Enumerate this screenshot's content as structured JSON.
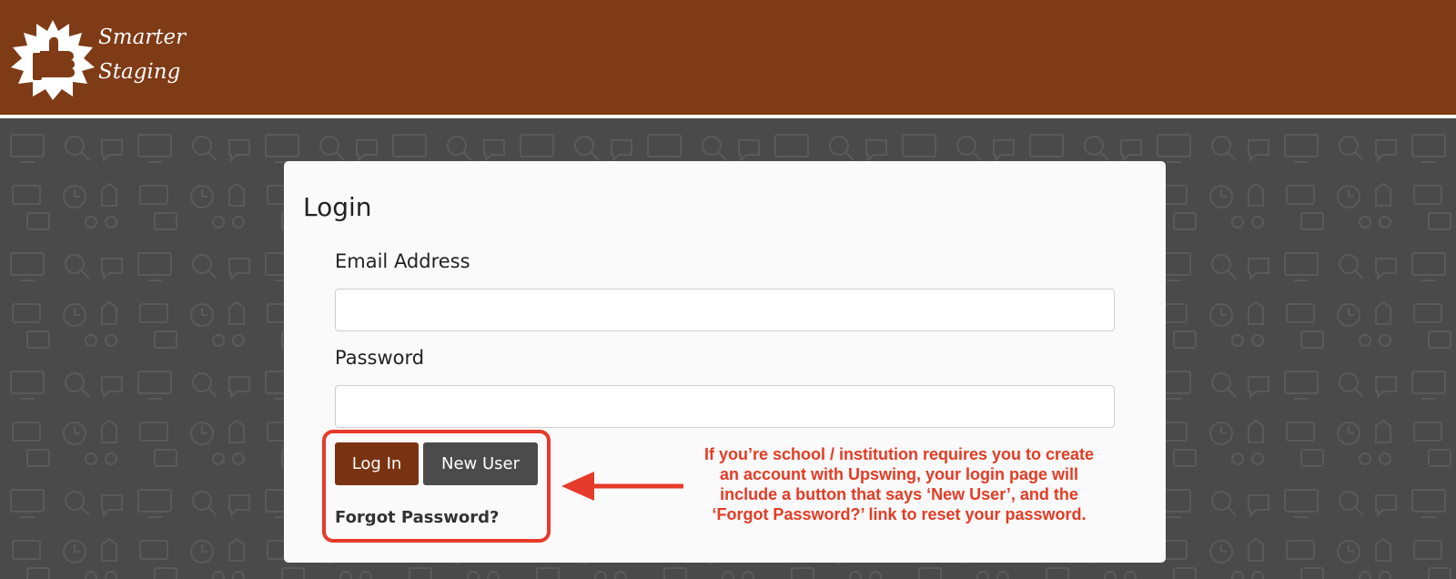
{
  "brand": {
    "line1": "Smarter",
    "line2": "Staging",
    "color": "#7f3a16"
  },
  "login": {
    "title": "Login",
    "email_label": "Email Address",
    "email_value": "",
    "email_placeholder": "",
    "password_label": "Password",
    "password_value": "",
    "password_placeholder": "",
    "login_button": "Log In",
    "new_user_button": "New User",
    "forgot_link": "Forgot Password?"
  },
  "annotation": {
    "line1": "If you’re school / institution requires you to create",
    "line2": "an account with Upswing, your login page will",
    "line3": "include a button that says ‘New User’, and the",
    "line4": "‘Forgot Password?’ link to reset your password.",
    "color": "#e53b24"
  }
}
